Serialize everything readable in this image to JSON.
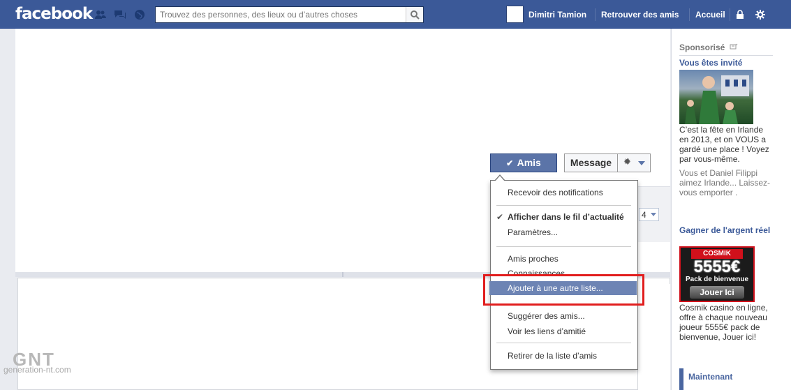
{
  "topbar": {
    "logo": "facebook",
    "search_placeholder": "Trouvez des personnes, des lieux ou d’autres choses",
    "user_name": "Dimitri Tamion",
    "find_friends": "Retrouver des amis",
    "home": "Accueil",
    "bg_color": "#3b5998",
    "icons": [
      "friend-requests-icon",
      "messages-icon",
      "notifications-icon",
      "search-icon",
      "privacy-lock-icon",
      "settings-gear-icon"
    ]
  },
  "profile_actions": {
    "friends_button": "Amis",
    "friends_check": "✔",
    "message_button": "Message",
    "gear": "✹"
  },
  "friend_count_select": "4",
  "menu": {
    "receive_notifications": "Recevoir des notifications",
    "show_in_feed": "Afficher dans le fil d’actualité",
    "show_in_feed_check": "✔",
    "settings": "Paramètres...",
    "close_friends": "Amis proches",
    "acquaintances": "Connaissances",
    "add_to_list": "Ajouter à une autre liste...",
    "suggest_friends": "Suggérer des amis...",
    "see_friendship": "Voir les liens d’amitié",
    "remove_friend": "Retirer de la liste d’amis",
    "highlight_color": "#6d84b4",
    "annotation_color": "#e11d1d"
  },
  "sidebar": {
    "sponsored": "Sponsorisé",
    "ad1_title": "Vous êtes invité",
    "ad1_text": "C’est la fête en Irlande en 2013, et on VOUS a gardé une place ! Voyez par vous-même.",
    "ad1_social": "Vous et Daniel Filippi aimez Irlande... Laissez-vous emporter .",
    "ad2_title": "Gagner de l'argent réel",
    "ad2_brand": "Cosmik",
    "ad2_amount": "5555€",
    "ad2_sub": "Pack de bienvenue",
    "ad2_cta": "Jouer Ici",
    "ad2_text": "Cosmik casino en ligne, offre à chaque nouveau joueur 5555€ pack de bienvenue, Jouer ici!",
    "now": "Maintenant"
  },
  "watermark": {
    "logo": "GNT",
    "site": "generation-nt.com"
  }
}
